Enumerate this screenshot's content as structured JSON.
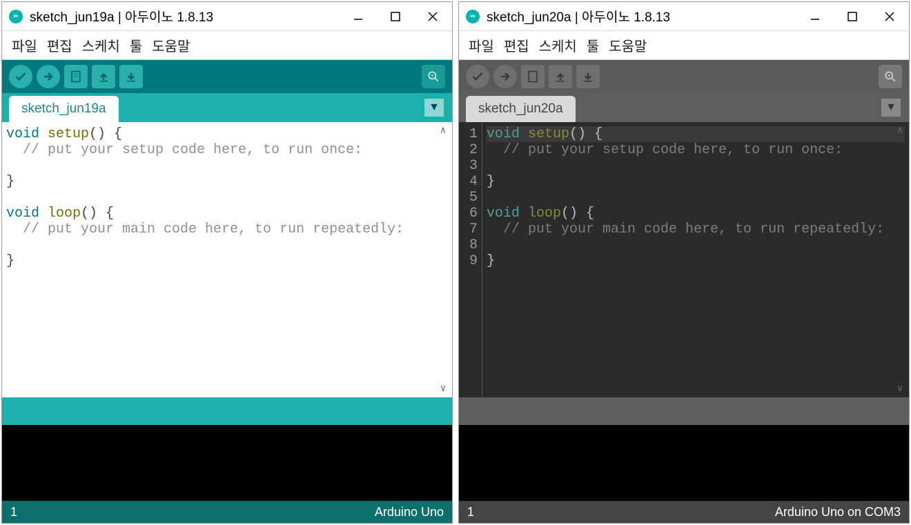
{
  "windows": [
    {
      "theme": "light",
      "title": "sketch_jun19a | 아두이노 1.8.13",
      "menu": [
        "파일",
        "편집",
        "스케치",
        "툴",
        "도움말"
      ],
      "tab": "sketch_jun19a",
      "show_gutter": false,
      "code_lines": [
        {
          "n": 1,
          "tokens": [
            {
              "t": "kw",
              "v": "void "
            },
            {
              "t": "fn",
              "v": "setup"
            },
            {
              "t": "",
              "v": "() {"
            }
          ]
        },
        {
          "n": 2,
          "tokens": [
            {
              "t": "cm",
              "v": "  // put your setup code here, to run once:"
            }
          ]
        },
        {
          "n": 3,
          "tokens": [
            {
              "t": "",
              "v": ""
            }
          ]
        },
        {
          "n": 4,
          "tokens": [
            {
              "t": "",
              "v": "}"
            }
          ]
        },
        {
          "n": 5,
          "tokens": [
            {
              "t": "",
              "v": ""
            }
          ]
        },
        {
          "n": 6,
          "tokens": [
            {
              "t": "kw",
              "v": "void "
            },
            {
              "t": "fn",
              "v": "loop"
            },
            {
              "t": "",
              "v": "() {"
            }
          ]
        },
        {
          "n": 7,
          "tokens": [
            {
              "t": "cm",
              "v": "  // put your main code here, to run repeatedly:"
            }
          ]
        },
        {
          "n": 8,
          "tokens": [
            {
              "t": "",
              "v": ""
            }
          ]
        },
        {
          "n": 9,
          "tokens": [
            {
              "t": "",
              "v": "}"
            }
          ]
        }
      ],
      "status_left": "1",
      "status_right": "Arduino Uno"
    },
    {
      "theme": "dark",
      "title": "sketch_jun20a | 아두이노 1.8.13",
      "menu": [
        "파일",
        "편집",
        "스케치",
        "툴",
        "도움말"
      ],
      "tab": "sketch_jun20a",
      "show_gutter": true,
      "highlight_line": 1,
      "code_lines": [
        {
          "n": 1,
          "tokens": [
            {
              "t": "kw",
              "v": "void "
            },
            {
              "t": "fn",
              "v": "setup"
            },
            {
              "t": "",
              "v": "() {"
            }
          ]
        },
        {
          "n": 2,
          "tokens": [
            {
              "t": "cm",
              "v": "  // put your setup code here, to run once:"
            }
          ]
        },
        {
          "n": 3,
          "tokens": [
            {
              "t": "",
              "v": ""
            }
          ]
        },
        {
          "n": 4,
          "tokens": [
            {
              "t": "",
              "v": "}"
            }
          ]
        },
        {
          "n": 5,
          "tokens": [
            {
              "t": "",
              "v": ""
            }
          ]
        },
        {
          "n": 6,
          "tokens": [
            {
              "t": "kw",
              "v": "void "
            },
            {
              "t": "fn",
              "v": "loop"
            },
            {
              "t": "",
              "v": "() {"
            }
          ]
        },
        {
          "n": 7,
          "tokens": [
            {
              "t": "cm",
              "v": "  // put your main code here, to run repeatedly:"
            }
          ]
        },
        {
          "n": 8,
          "tokens": [
            {
              "t": "",
              "v": ""
            }
          ]
        },
        {
          "n": 9,
          "tokens": [
            {
              "t": "",
              "v": "}"
            }
          ]
        }
      ],
      "status_left": "1",
      "status_right": "Arduino Uno on COM3"
    }
  ],
  "icons": {
    "app": "∞",
    "minimize": "min",
    "maximize": "max",
    "close": "close"
  }
}
